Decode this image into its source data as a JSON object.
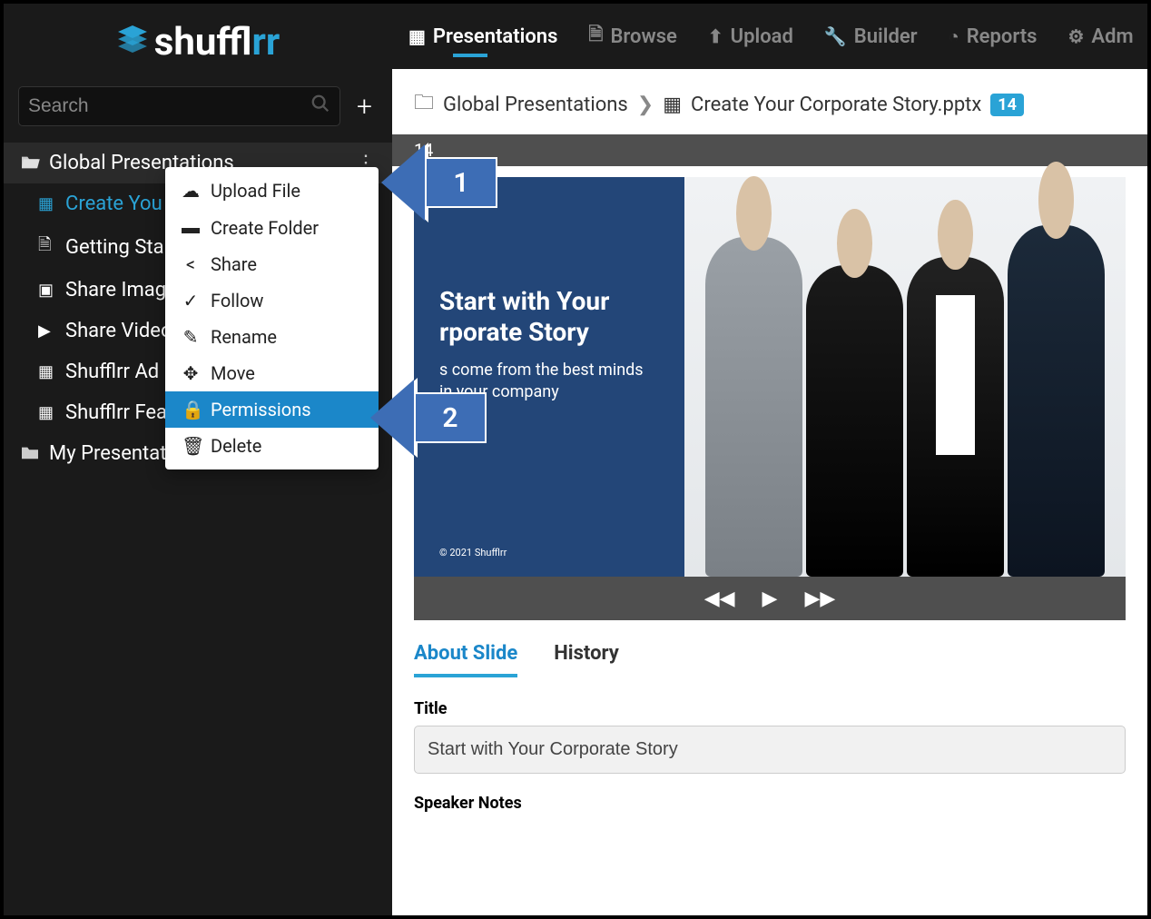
{
  "brand": {
    "name": "shufflrr",
    "suffix": "rr"
  },
  "search": {
    "placeholder": "Search"
  },
  "sidebar": {
    "folders": [
      {
        "label": "Global Presentations",
        "open": true
      },
      {
        "label": "My Presentations",
        "open": false
      }
    ],
    "items": [
      {
        "label": "Create You",
        "active": true,
        "icon": "p"
      },
      {
        "label": "Getting Sta",
        "icon": "pdf"
      },
      {
        "label": "Share Imag",
        "icon": "img"
      },
      {
        "label": "Share Video",
        "icon": "vid"
      },
      {
        "label": "Shufflrr Ad",
        "icon": "p"
      },
      {
        "label": "Shufflrr Fea",
        "icon": "p"
      }
    ]
  },
  "context_menu": [
    {
      "label": "Upload File",
      "icon": "⬆",
      "selected": false
    },
    {
      "label": "Create Folder",
      "icon": "📁",
      "selected": false
    },
    {
      "label": "Share",
      "icon": "↗",
      "selected": false
    },
    {
      "label": "Follow",
      "icon": "✓",
      "selected": false
    },
    {
      "label": "Rename",
      "icon": "✎",
      "selected": false
    },
    {
      "label": "Move",
      "icon": "✥",
      "selected": false
    },
    {
      "label": "Permissions",
      "icon": "🔒",
      "selected": true
    },
    {
      "label": "Delete",
      "icon": "🗑",
      "selected": false
    }
  ],
  "annotations": {
    "arrow1": "1",
    "arrow2": "2"
  },
  "topnav": [
    {
      "label": "Presentations",
      "active": true
    },
    {
      "label": "Browse"
    },
    {
      "label": "Upload"
    },
    {
      "label": "Builder"
    },
    {
      "label": "Reports"
    },
    {
      "label": "Adm"
    }
  ],
  "breadcrumb": {
    "folder": "Global Presentations",
    "file": "Create Your Corporate Story.pptx",
    "badge": "14"
  },
  "slide_bar": "14",
  "slide": {
    "title_line1": "Start with Your",
    "title_line2": "rporate Story",
    "subtitle": "s come from the best minds in your company",
    "copyright": "© 2021 Shufflrr"
  },
  "tabs": [
    {
      "label": "About Slide",
      "active": true
    },
    {
      "label": "History"
    }
  ],
  "form": {
    "title_label": "Title",
    "title_value": "Start with Your Corporate Story",
    "notes_label": "Speaker Notes"
  }
}
